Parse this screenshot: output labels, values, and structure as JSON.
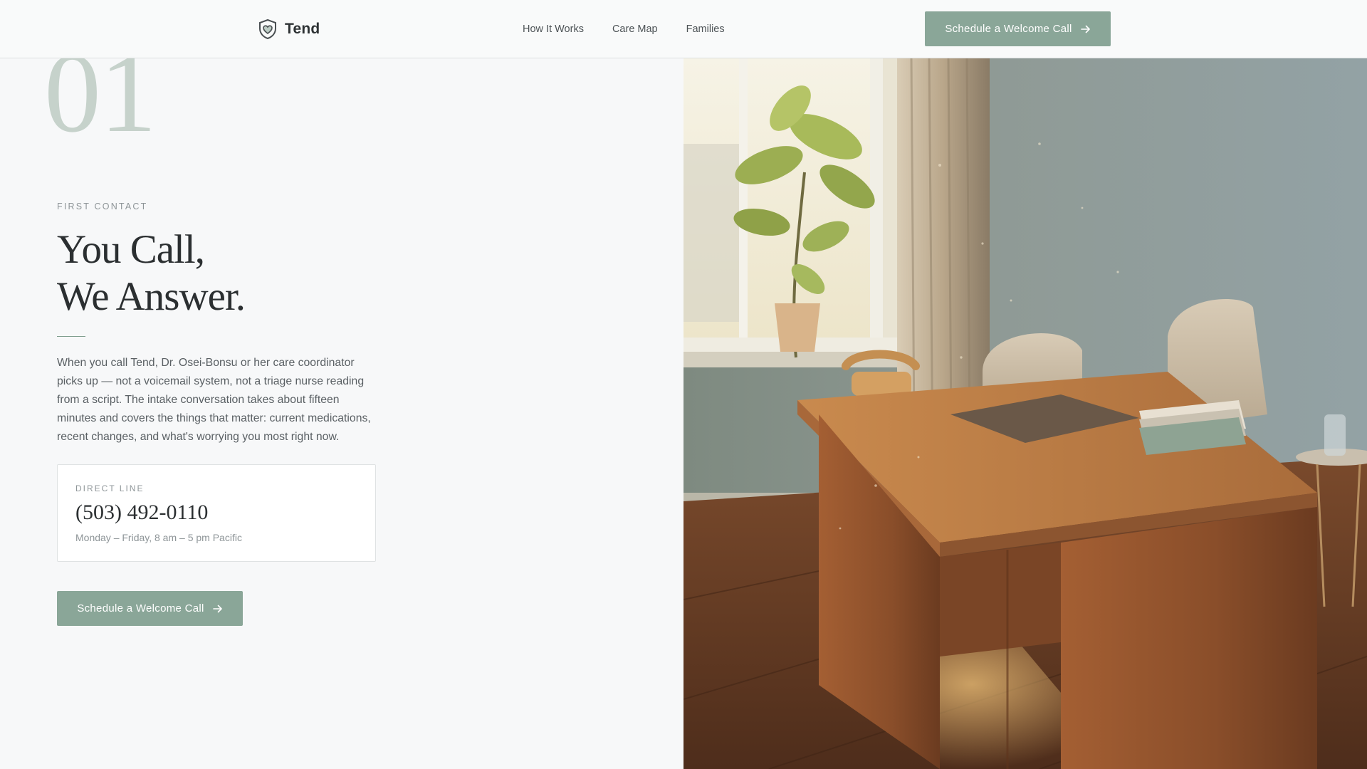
{
  "header": {
    "brand": "Tend",
    "nav": [
      {
        "label": "How It Works"
      },
      {
        "label": "Care Map"
      },
      {
        "label": "Families"
      }
    ],
    "cta_label": "Schedule a Welcome Call"
  },
  "hero_section": {
    "number": "01",
    "eyebrow": "FIRST CONTACT",
    "headline_line1": "You Call,",
    "headline_line2": "We Answer.",
    "body": "When you call Tend, Dr. Osei-Bonsu or her care coordinator picks up — not a voicemail system, not a triage nurse reading from a script. The intake conversation takes about fifteen minutes and covers the things that matter: current medications, recent changes, and what's worrying you most right now.",
    "card": {
      "label": "DIRECT LINE",
      "phone": "(503) 492-0110",
      "hours": "Monday – Friday, 8 am – 5 pm Pacific"
    },
    "cta_label": "Schedule a Welcome Call"
  },
  "colors": {
    "accent": "#8aa698",
    "big_number": "#c6d2cb",
    "background": "#f7f8f9",
    "text": "#2b2f31"
  },
  "icons": {
    "brand": "shield-heart-icon",
    "button_arrow": "arrow-right-icon"
  }
}
